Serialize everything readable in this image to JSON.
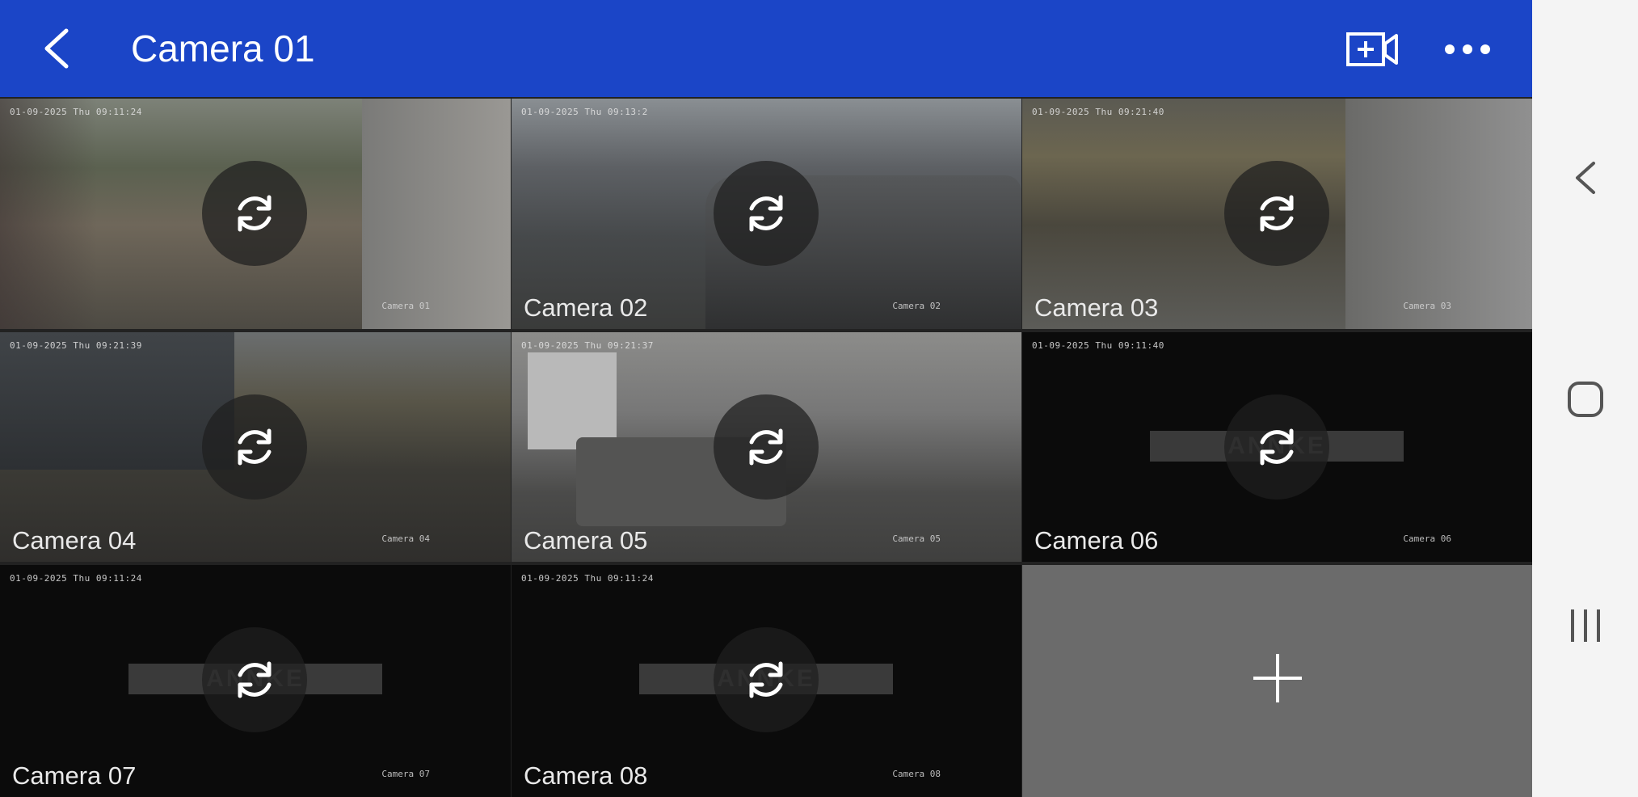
{
  "header": {
    "title": "Camera 01",
    "back_icon": "chevron-left-icon",
    "add_camera_icon": "video-add-icon",
    "more_icon": "more-horizontal-icon",
    "bar_color": "#1b45c7"
  },
  "cameras": [
    {
      "label": "Camera 01",
      "timestamp": "01-09-2025 Thu 09:11:24",
      "osd_name": "Camera 01",
      "brand": "",
      "selected": true
    },
    {
      "label": "Camera 02",
      "timestamp": "01-09-2025 Thu 09:13:2",
      "osd_name": "Camera 02",
      "brand": "",
      "selected": false
    },
    {
      "label": "Camera 03",
      "timestamp": "01-09-2025 Thu 09:21:40",
      "osd_name": "Camera 03",
      "brand": "",
      "selected": false
    },
    {
      "label": "Camera 04",
      "timestamp": "01-09-2025 Thu 09:21:39",
      "osd_name": "Camera 04",
      "brand": "",
      "selected": false
    },
    {
      "label": "Camera 05",
      "timestamp": "01-09-2025 Thu 09:21:37",
      "osd_name": "Camera 05",
      "brand": "",
      "selected": false
    },
    {
      "label": "Camera 06",
      "timestamp": "01-09-2025 Thu 09:11:40",
      "osd_name": "Camera 06",
      "brand": "ANNKE",
      "selected": false
    },
    {
      "label": "Camera 07",
      "timestamp": "01-09-2025 Thu 09:11:24",
      "osd_name": "Camera 07",
      "brand": "ANNKE",
      "selected": false
    },
    {
      "label": "Camera 08",
      "timestamp": "01-09-2025 Thu 09:11:24",
      "osd_name": "Camera 08",
      "brand": "ANNKE",
      "selected": false
    }
  ],
  "add_tile": {
    "icon": "plus-icon"
  },
  "system_nav": {
    "back_icon": "chevron-left-icon",
    "home_icon": "home-square-icon",
    "recents_icon": "recents-icon"
  }
}
